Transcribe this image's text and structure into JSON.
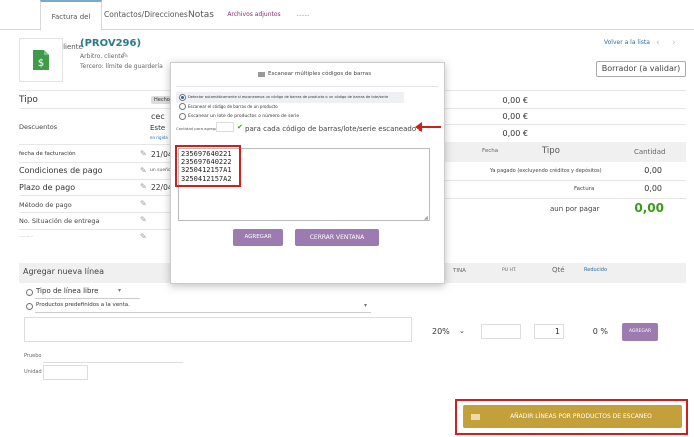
{
  "tabs": [
    {
      "label": "Factura del cliente",
      "active": true
    },
    {
      "label": "Contactos/Direcciones"
    },
    {
      "label": "Notas"
    },
    {
      "label": "Archivos adjuntos"
    },
    {
      "label": "........"
    }
  ],
  "header": {
    "ref": "(PROV296)",
    "arbitro_label": "Arbitro. cliente",
    "tercero": "Tercero: límite de guardería",
    "back_link": "Volver a la lista",
    "status": "Borrador (a validar)"
  },
  "left_fields": {
    "tipo": "Tipo",
    "tipo_badge": "Hecho",
    "descuentos": "Descuentos",
    "desc_val1": "cec",
    "desc_val2": "Este",
    "desc_sub": "en rígida",
    "fecha_facturacion": "fecha de facturación",
    "fecha_facturacion_val": "21/04",
    "condiciones_pago": "Condiciones de pago",
    "condiciones_val": "un sueño",
    "plazo_pago": "Plazo de pago",
    "plazo_val": "22/04",
    "metodo_pago": "Método de pago",
    "situacion_entrega": "No. Situación de entrega",
    "extra": "..........."
  },
  "right_summary": {
    "amount1": "0,00 €",
    "amount2": "0,00 €",
    "amount3": "0,00 €",
    "col_fecha": "Fecha",
    "col_tipo": "Tipo",
    "col_cantidad": "Cantidad",
    "row1_label": "Ya pagado (excluyendo créditos y depósitos)",
    "row1_val": "0,00",
    "row2_label": "Factura",
    "row2_val": "0,00",
    "row3_label": "aun por pagar",
    "row3_val": "0,00"
  },
  "new_line": {
    "title": "Agregar nueva línea",
    "col_tina": "TINA",
    "col_puht": "PU HT.",
    "col_qte": "Qté",
    "col_reducido": "Reducido",
    "tipo_linea": "Tipo de línea libre",
    "productos": "Productos predefinidos a la venta.",
    "vat": "20%",
    "qty": "1",
    "pct": "0 %",
    "add_button": "AGREGAR",
    "pruebo": "Pruebo",
    "unidad": "Unidad"
  },
  "scan_button": "AÑADIR LÍNEAS POR PRODUCTOS DE ESCANEO",
  "modal": {
    "title": "Escanear múltiples códigos de barras",
    "option1": "Detectar automáticamente si escaneamos un código de barras de producto o un código de barras de lote/serie",
    "option2": "Escanear el código de barras de un producto",
    "option3": "Escanear un lote de productos o número de serie",
    "cantidad_label": "Cantidad para agregar",
    "hint": "para cada código de barras/lote/serie escaneado 3",
    "codes": [
      "235697640221",
      "235697640222",
      "3250412157A1",
      "3250412157A2"
    ],
    "add_button": "AGREGAR",
    "close_button": "CERRAR VENTANA"
  },
  "colors": {
    "accent": "#2b7a8a",
    "purple": "#9b7bb0",
    "red": "#d0201b",
    "gold": "#c3a03a",
    "green": "#3a9a1c"
  }
}
